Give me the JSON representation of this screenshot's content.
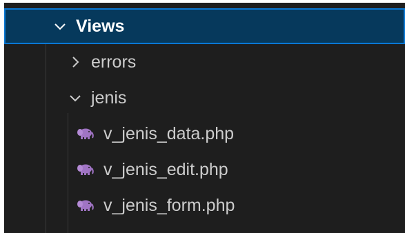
{
  "explorer": {
    "folders": {
      "views": {
        "label": "Views",
        "expanded": true
      },
      "errors": {
        "label": "errors",
        "expanded": false
      },
      "jenis": {
        "label": "jenis",
        "expanded": true
      }
    },
    "files": [
      {
        "label": "v_jenis_data.php",
        "icon": "php-elephant-icon"
      },
      {
        "label": "v_jenis_edit.php",
        "icon": "php-elephant-icon"
      },
      {
        "label": "v_jenis_form.php",
        "icon": "php-elephant-icon"
      }
    ]
  },
  "colors": {
    "background": "#1e1e1e",
    "selection": "#06395c",
    "focus_border": "#0a78d4",
    "text": "#cccccc",
    "php_icon": "#a074c4"
  }
}
